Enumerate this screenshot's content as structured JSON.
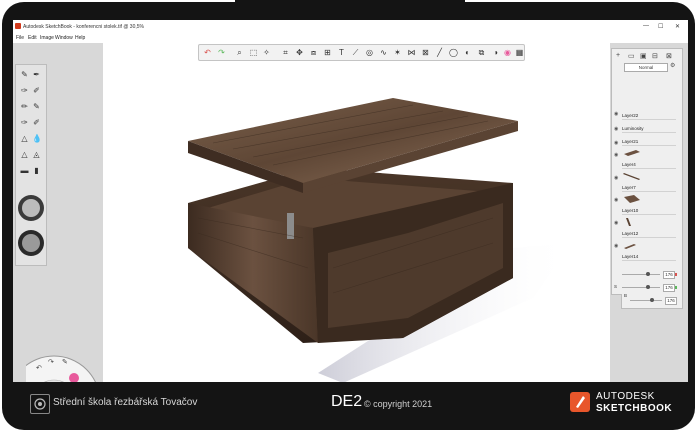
{
  "window": {
    "title": "Autodesk SketchBook - konferencni stolek.tif @ 30,5%",
    "minimize": "—",
    "maximize": "☐",
    "close": "✕"
  },
  "menu": {
    "items": [
      "File",
      "Edit",
      "Image",
      "Window",
      "Help"
    ]
  },
  "layers": {
    "blend_mode": "Normal",
    "items": [
      {
        "name": "Layer22"
      },
      {
        "name": "Luminosity"
      },
      {
        "name": "Layer21"
      },
      {
        "name": "Layer4"
      },
      {
        "name": "Layer7"
      },
      {
        "name": "Layer10"
      },
      {
        "name": "Layer12"
      },
      {
        "name": "Layer14"
      }
    ]
  },
  "color_sliders": [
    {
      "label": "",
      "value": "176",
      "fraction": 0.69,
      "color": "#d9534f"
    },
    {
      "label": "S",
      "value": "176",
      "fraction": 0.69,
      "color": "#5cb85c"
    },
    {
      "label": "B",
      "value": "176",
      "fraction": 0.69,
      "color": "#428bca"
    }
  ],
  "footer": {
    "school": "Střední škola řezbářská Tovačov",
    "project": "DE2",
    "copyright": "© copyright 2021",
    "brand_line1": "AUTODESK",
    "brand_line2": "SKETCHBOOK"
  },
  "colors": {
    "bezel": "#141414",
    "wood_dark": "#3a2a1f",
    "wood_mid": "#6b5140",
    "wood_light": "#8a6e58",
    "autodesk_orange": "#e8562b"
  }
}
